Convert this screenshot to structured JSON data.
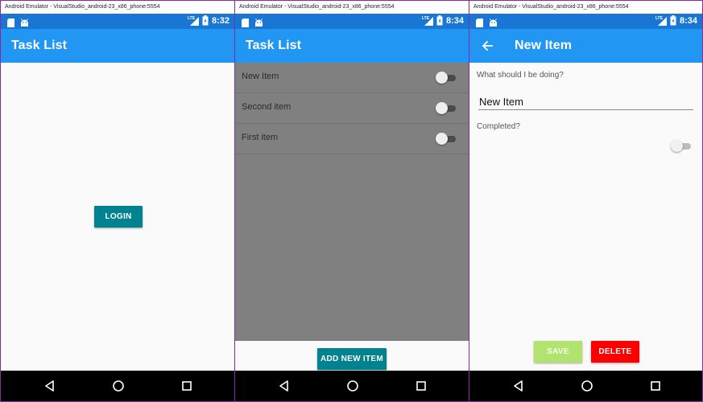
{
  "windows": [
    {
      "titlebar": "Android Emulator - VisualStudio_android-23_x86_phone:5554",
      "status_time": "8:32",
      "appbar_title": "Task List",
      "login_label": "LOGIN"
    },
    {
      "titlebar": "Android Emulator - VisualStudio_android-23_x86_phone:5554",
      "status_time": "8:34",
      "appbar_title": "Task List",
      "tasks": [
        {
          "label": "New Item",
          "completed": false
        },
        {
          "label": "Second item",
          "completed": false
        },
        {
          "label": "First item",
          "completed": false
        }
      ],
      "add_label": "ADD NEW ITEM"
    },
    {
      "titlebar": "Android Emulator - VisualStudio_android-23_x86_phone:5554",
      "status_time": "8:34",
      "appbar_title": "New Item",
      "field_question": "What should I be doing?",
      "field_value": "New Item",
      "completed_label": "Completed?",
      "completed": false,
      "save_label": "SAVE",
      "delete_label": "DELETE"
    }
  ],
  "status": {
    "network": "LTE"
  },
  "colors": {
    "status_bar": "#1976d2",
    "app_bar": "#2196f3",
    "primary_button": "#00838f",
    "save_button": "#b2e36e",
    "delete_button": "#ff0000",
    "overlay": "#808080"
  },
  "icons": {
    "status_left": [
      "sd-card-icon",
      "android-icon"
    ],
    "status_right": [
      "lte-signal-icon",
      "battery-icon"
    ],
    "nav": [
      "back-triangle-icon",
      "home-circle-icon",
      "recents-square-icon"
    ],
    "appbar": "back-arrow-icon"
  }
}
